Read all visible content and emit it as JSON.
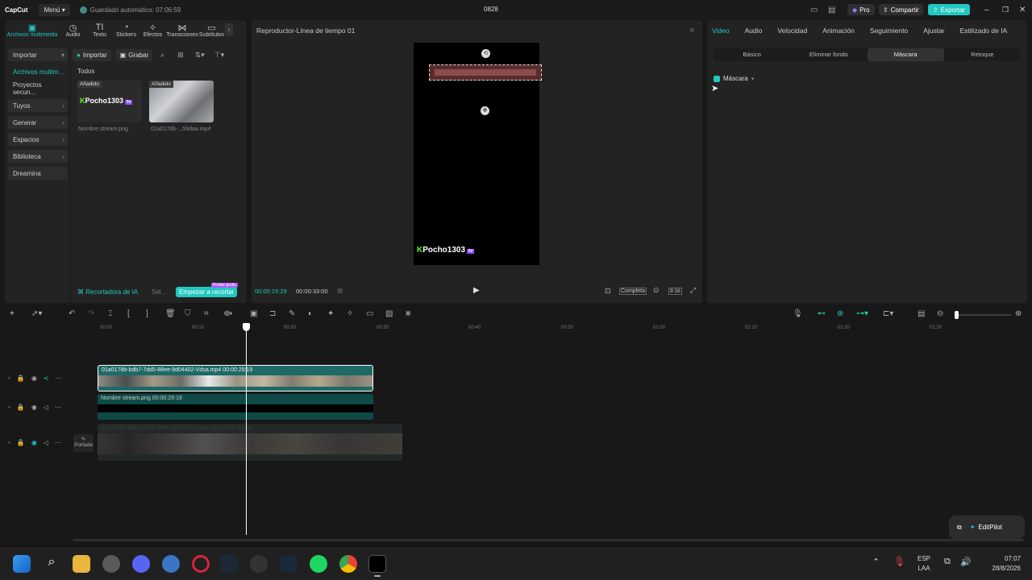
{
  "titlebar": {
    "logo": "CapCut",
    "menu": "Menú",
    "autosave": "Guardado automático: 07:06:59",
    "project_name": "0828",
    "pro": "Pro",
    "share": "Compartir",
    "export": "Exportar",
    "accent": "#21c8c1"
  },
  "left": {
    "tabs": [
      "Archivos multimedia",
      "Audio",
      "Texto",
      "Stickers",
      "Efectos",
      "Transiciones",
      "Subtítulos"
    ],
    "nav": [
      "Importar",
      "Archivos multim...",
      "Proyectos secun...",
      "Tuyos",
      "Generar",
      "Espacios",
      "Biblioteca",
      "Dreamina"
    ],
    "import_btn": "Importar",
    "record_btn": "Grabar",
    "section": "Todos",
    "media": [
      {
        "badge": "Añadido",
        "caption": "Nombre stream.png",
        "logo_text": "Pocho1303"
      },
      {
        "badge": "Añadido",
        "caption": "01a0178b-...59daa.mp4"
      }
    ],
    "promo_left": "Recortadora de IA",
    "promo_sel": "Sel...",
    "promo_btn": "Empezar a recortar",
    "promo_tag": "Probar gratis"
  },
  "player": {
    "title": "Reproductor-Línea de tiempo 01",
    "current_time": "00:00:15:29",
    "total_time": "00:00:33:00",
    "complete": "Completa",
    "ratio": "9:16",
    "canvas_logo": "Pocho1303"
  },
  "right": {
    "tabs": [
      "Video",
      "Audio",
      "Velocidad",
      "Animación",
      "Seguimiento",
      "Ajustar",
      "Estilizado de IA"
    ],
    "subtabs": [
      "Básico",
      "Eliminar fondo",
      "Máscara",
      "Retoque"
    ],
    "mask_label": "Máscara"
  },
  "timeline": {
    "ruler": [
      "00:00",
      "00:10",
      "00:20",
      "00:30",
      "00:40",
      "00:50",
      "01:00",
      "01:10",
      "01:20",
      "01:30"
    ],
    "clip1": "01a0178b-bdb7-7dd5-88ee-9d04402-Vdsa.mp4  00:00:29:19",
    "clip2": "Nombre stream.png  00:00:29:19",
    "clip3": "01a0178b-bdb7-7dd5-88ee-9d04402-Vdsa.mp4  00:00:32:00",
    "cover": "Portada",
    "editpilot": "EditPilot"
  },
  "taskbar": {
    "lang": "ESP",
    "region": "LAA",
    "time": "07:07",
    "date": "28/8/2026"
  }
}
